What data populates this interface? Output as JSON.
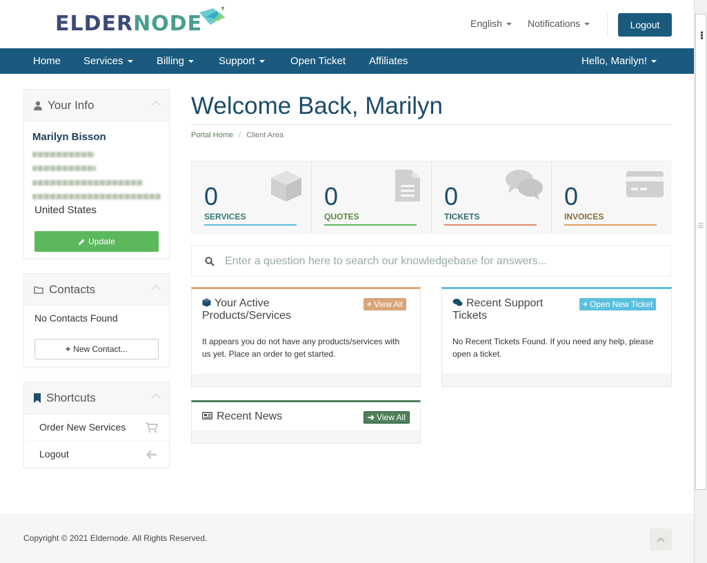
{
  "brand": {
    "name_part1": "ELDER",
    "name_part2": "NODE"
  },
  "header": {
    "language": "English",
    "notifications": "Notifications",
    "logout": "Logout"
  },
  "nav": {
    "home": "Home",
    "services": "Services",
    "billing": "Billing",
    "support": "Support",
    "open_ticket": "Open Ticket",
    "affiliates": "Affiliates",
    "greeting": "Hello, Marilyn!"
  },
  "sidebar": {
    "your_info": {
      "title": "Your Info",
      "name": "Marilyn Bisson",
      "country": "United States",
      "update_label": "Update"
    },
    "contacts": {
      "title": "Contacts",
      "empty_text": "No Contacts Found",
      "new_contact_label": "New Contact..."
    },
    "shortcuts": {
      "title": "Shortcuts",
      "items": [
        {
          "label": "Order New Services",
          "icon": "cart-icon"
        },
        {
          "label": "Logout",
          "icon": "arrow-left-icon"
        }
      ]
    }
  },
  "main": {
    "title": "Welcome Back, Marilyn",
    "breadcrumb": {
      "home": "Portal Home",
      "current": "Client Area"
    },
    "tiles": [
      {
        "count": "0",
        "label": "SERVICES",
        "color": "#5bc0de",
        "label_color": "#337a6f",
        "icon": "cube-icon"
      },
      {
        "count": "0",
        "label": "QUOTES",
        "color": "#5cb85c",
        "label_color": "#5a8a3c",
        "icon": "document-icon"
      },
      {
        "count": "0",
        "label": "TICKETS",
        "color": "#d9896a",
        "label_color": "#2f6a66",
        "icon": "comments-icon"
      },
      {
        "count": "0",
        "label": "INVOICES",
        "color": "#e0a060",
        "label_color": "#8a6a30",
        "icon": "credit-card-icon"
      }
    ],
    "search": {
      "placeholder": "Enter a question here to search our knowledgebase for answers..."
    },
    "cards": {
      "products": {
        "title_line1": "Your Active",
        "title_line2": "Products/Services",
        "button": "View All",
        "body": "It appears you do not have any products/services with us yet. Place an order to get started.",
        "accent": "#d9a57a"
      },
      "tickets": {
        "title_line1": "Recent Support",
        "title_line2": "Tickets",
        "button": "Open New Ticket",
        "body": "No Recent Tickets Found. If you need any help, please open a ticket.",
        "accent": "#5bc0de"
      },
      "news": {
        "title": "Recent News",
        "button": "View All",
        "accent": "#4e7f5b"
      }
    }
  },
  "footer": {
    "copyright": "Copyright © 2021 Eldernode. All Rights Reserved."
  }
}
